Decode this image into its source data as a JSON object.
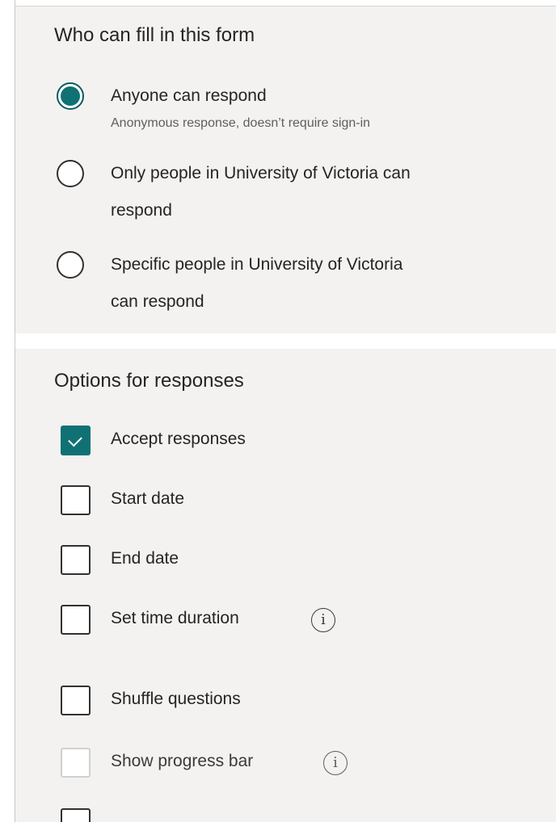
{
  "who_section": {
    "title": "Who can fill in this form",
    "options": [
      {
        "label": "Anyone can respond",
        "sub": "Anonymous response, doesn’t require sign-in",
        "selected": true
      },
      {
        "label_line1": "Only people in University of Victoria can",
        "label_line2": "respond",
        "selected": false
      },
      {
        "label_line1": "Specific people in University of Victoria",
        "label_line2": "can respond",
        "selected": false
      }
    ]
  },
  "options_section": {
    "title": "Options for responses",
    "items": [
      {
        "label": "Accept responses",
        "checked": true
      },
      {
        "label": "Start date",
        "checked": false
      },
      {
        "label": "End date",
        "checked": false
      },
      {
        "label": "Set time duration",
        "checked": false,
        "info_icon": "info-icon"
      },
      {
        "label": "Shuffle questions",
        "checked": false
      },
      {
        "label": "Show progress bar",
        "checked": false,
        "disabled": true,
        "info_icon": "info-icon"
      }
    ]
  },
  "icons": {
    "info_glyph": "i"
  },
  "colors": {
    "accent": "#0f7173",
    "panel_bg": "#f3f2f1",
    "text": "#252423",
    "subtext": "#605e5c"
  }
}
